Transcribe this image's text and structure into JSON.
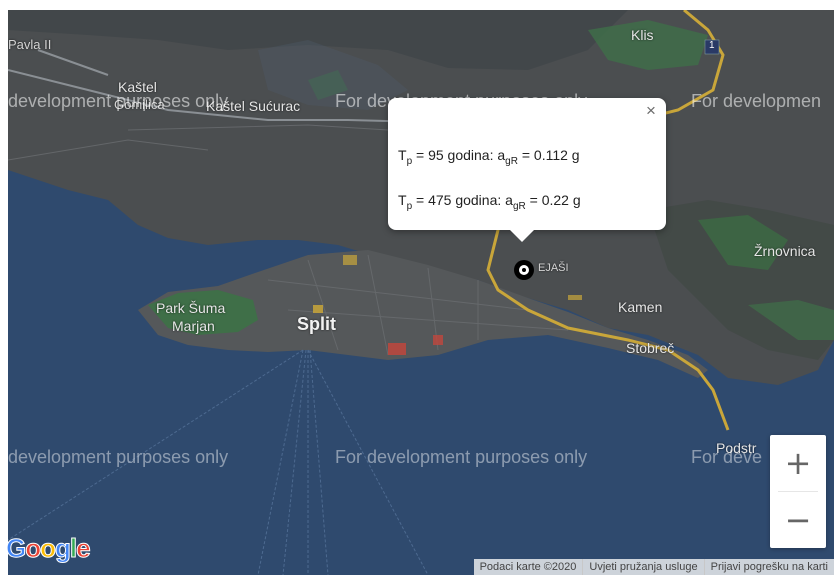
{
  "places": {
    "pavla": "Pavla II",
    "klis": "Klis",
    "kastel": "Kaštel",
    "gomilica": "Gomilica",
    "sucurac": "Kaštel Sućurac",
    "park_line1": "Park Šuma",
    "park_line2": "Marjan",
    "split": "Split",
    "kamen": "Kamen",
    "stobrec": "Stobreč",
    "zrnovnica": "Žrnovnica",
    "neighborhood": "EJAŠI",
    "podstrana": "Podstr",
    "route_shield": "1"
  },
  "watermark": {
    "text_a": "development purposes only",
    "text_b": "For development purposes only",
    "text_c": "For developmen",
    "text_d": "For deve"
  },
  "popup": {
    "line1_prefix": "T",
    "line1_sub": "p",
    "line1_mid": " =  95 godina: a",
    "line1_sub2": "gR",
    "line1_value": " = 0.112 g",
    "line2_prefix": "T",
    "line2_sub": "p",
    "line2_mid": " = 475 godina: a",
    "line2_sub2": "gR",
    "line2_value": " = 0.22 g",
    "close_glyph": "×"
  },
  "zoom": {
    "in_label": "+",
    "out_label": "−"
  },
  "attribution": {
    "data": "Podaci karte ©2020",
    "terms": "Uvjeti pružanja usluge",
    "report": "Prijavi pogrešku na karti"
  },
  "logo": {
    "letters": [
      "G",
      "o",
      "o",
      "g",
      "l",
      "e"
    ],
    "colors": [
      "#4285F4",
      "#EA4335",
      "#FBBC05",
      "#4285F4",
      "#34A853",
      "#EA4335"
    ]
  },
  "colors": {
    "sea": "#2f4a6e",
    "land": "#4b4e50",
    "urban": "#5d5f61",
    "park": "#3f7a4a",
    "highway": "#c9a63a"
  }
}
